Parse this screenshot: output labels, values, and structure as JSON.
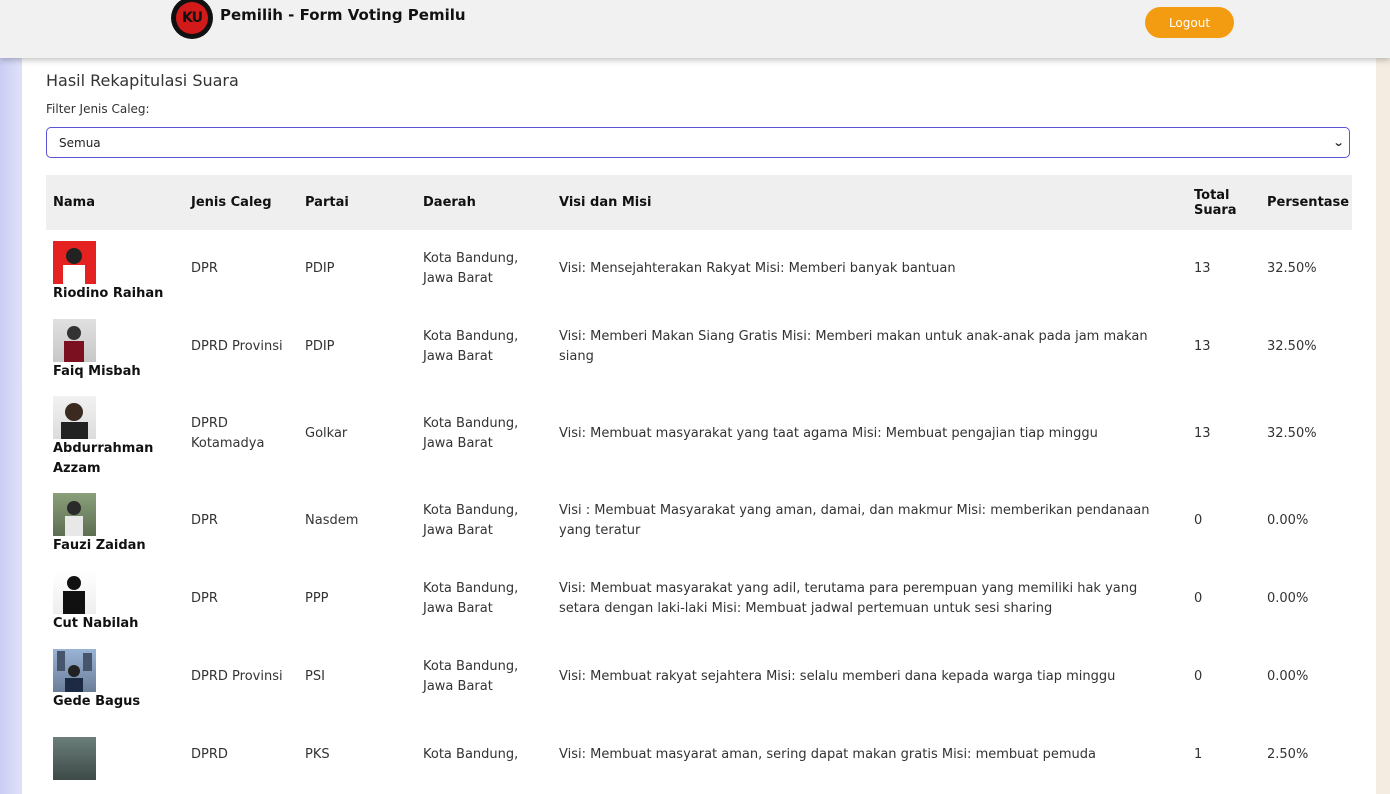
{
  "header": {
    "title": "Pemilih - Form Voting Pemilu",
    "logo_text": "KU",
    "logout_label": "Logout"
  },
  "page": {
    "title": "Hasil Rekapitulasi Suara",
    "filter_label": "Filter Jenis Caleg:",
    "filter_value": "Semua"
  },
  "table": {
    "headers": [
      "Nama",
      "Jenis Caleg",
      "Partai",
      "Daerah",
      "Visi dan Misi",
      "Total Suara",
      "Persentase"
    ],
    "rows": [
      {
        "nama": "Riodino Raihan",
        "jenis": "DPR",
        "partai": "PDIP",
        "daerah": "Kota Bandung, Jawa Barat",
        "visi": "Visi: Mensejahterakan Rakyat Misi: Memberi banyak bantuan",
        "total": "13",
        "persen": "32.50%"
      },
      {
        "nama": "Faiq Misbah",
        "jenis": "DPRD Provinsi",
        "partai": "PDIP",
        "daerah": "Kota Bandung, Jawa Barat",
        "visi": "Visi: Memberi Makan Siang Gratis Misi: Memberi makan untuk anak-anak pada jam makan siang",
        "total": "13",
        "persen": "32.50%"
      },
      {
        "nama": "Abdurrahman Azzam",
        "jenis": "DPRD Kotamadya",
        "partai": "Golkar",
        "daerah": "Kota Bandung, Jawa Barat",
        "visi": "Visi: Membuat masyarakat yang taat agama Misi: Membuat pengajian tiap minggu",
        "total": "13",
        "persen": "32.50%"
      },
      {
        "nama": "Fauzi Zaidan",
        "jenis": "DPR",
        "partai": "Nasdem",
        "daerah": "Kota Bandung, Jawa Barat",
        "visi": "Visi : Membuat Masyarakat yang aman, damai, dan makmur Misi: memberikan pendanaan yang teratur",
        "total": "0",
        "persen": "0.00%"
      },
      {
        "nama": "Cut Nabilah",
        "jenis": "DPR",
        "partai": "PPP",
        "daerah": "Kota Bandung, Jawa Barat",
        "visi": "Visi: Membuat masyarakat yang adil, terutama para perempuan yang memiliki hak yang setara dengan laki-laki Misi: Membuat jadwal pertemuan untuk sesi sharing",
        "total": "0",
        "persen": "0.00%"
      },
      {
        "nama": "Gede Bagus",
        "jenis": "DPRD Provinsi",
        "partai": "PSI",
        "daerah": "Kota Bandung, Jawa Barat",
        "visi": "Visi: Membuat rakyat sejahtera Misi: selalu memberi dana kepada warga tiap minggu",
        "total": "0",
        "persen": "0.00%"
      },
      {
        "nama": "",
        "jenis": "DPRD",
        "partai": "PKS",
        "daerah": "Kota Bandung,",
        "visi": "Visi: Membuat masyarat aman, sering dapat makan gratis Misi: membuat pemuda",
        "total": "1",
        "persen": "2.50%"
      }
    ]
  }
}
